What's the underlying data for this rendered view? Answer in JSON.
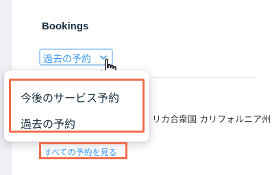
{
  "bookings": {
    "title": "Bookings",
    "filter_selected": "過去の予約",
    "filter_icon": "chevron-down-icon",
    "location_text": "リカ合衆国 カリフォルニア州",
    "see_all_link": "すべての予約を見る"
  },
  "dropdown": {
    "options": [
      "今後のサービス予約",
      "過去の予約"
    ]
  },
  "colors": {
    "accent": "#3899ec",
    "annotation": "#f06b4a",
    "heading": "#162d3d",
    "focus_border": "#a8cdf7"
  }
}
